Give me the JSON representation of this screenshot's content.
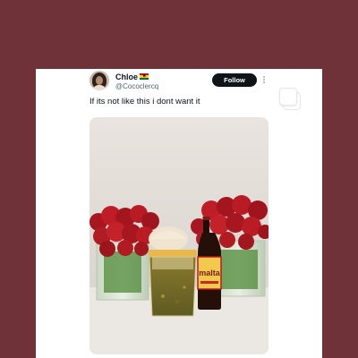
{
  "tweet": {
    "display_name": "Chloe",
    "flag_icon": "ghana-flag-icon",
    "handle": "@Cococlercq",
    "follow_label": "Follow",
    "text": "If its not like this i dont want it"
  },
  "photo": {
    "bottle_label": "malta"
  },
  "colors": {
    "page_background": "#6e3238",
    "card_background": "#ffffff",
    "follow_button": "#0f1419",
    "roses": "#b01c24"
  }
}
